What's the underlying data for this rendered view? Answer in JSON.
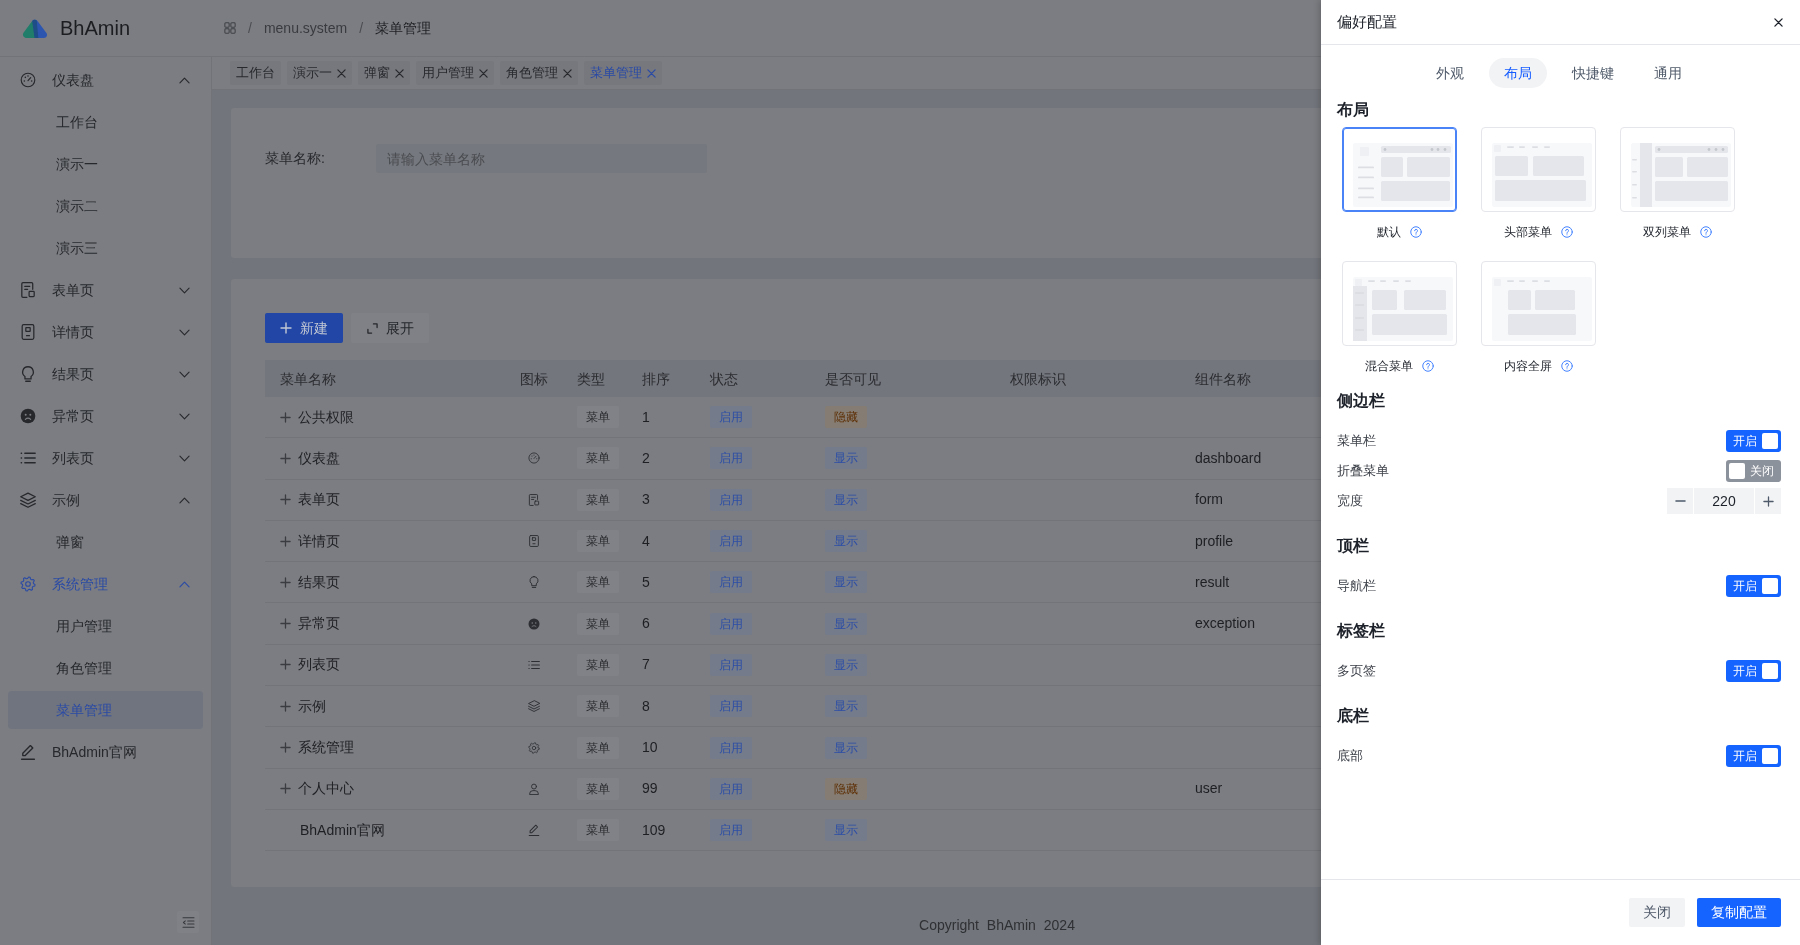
{
  "header": {
    "logo_text": "BhAmin",
    "breadcrumb": [
      {
        "separator": "/",
        "label": "menu.system"
      },
      {
        "separator": "/",
        "label": "菜单管理"
      }
    ]
  },
  "sidebar": {
    "items": [
      {
        "label": "仪表盘",
        "kind": "group",
        "expanded": true,
        "children": [
          {
            "label": "工作台",
            "selected": false
          },
          {
            "label": "演示一",
            "selected": false
          },
          {
            "label": "演示二",
            "selected": false
          },
          {
            "label": "演示三",
            "selected": false
          }
        ]
      },
      {
        "label": "表单页",
        "kind": "group",
        "expanded": false
      },
      {
        "label": "详情页",
        "kind": "group",
        "expanded": false
      },
      {
        "label": "结果页",
        "kind": "group",
        "expanded": false
      },
      {
        "label": "异常页",
        "kind": "group",
        "expanded": false
      },
      {
        "label": "列表页",
        "kind": "group",
        "expanded": false
      },
      {
        "label": "示例",
        "kind": "group",
        "expanded": true,
        "children": [
          {
            "label": "弹窗",
            "selected": false
          }
        ]
      },
      {
        "label": "系统管理",
        "kind": "group",
        "expanded": true,
        "children": [
          {
            "label": "用户管理",
            "selected": false
          },
          {
            "label": "角色管理",
            "selected": false
          },
          {
            "label": "菜单管理",
            "selected": true
          }
        ]
      },
      {
        "label": "BhAdmin官网",
        "kind": "link",
        "selected": false
      }
    ]
  },
  "tabs": [
    {
      "label": "工作台",
      "closable": false,
      "selected": false
    },
    {
      "label": "演示一",
      "closable": true,
      "selected": false
    },
    {
      "label": "弹窗",
      "closable": true,
      "selected": false
    },
    {
      "label": "用户管理",
      "closable": true,
      "selected": false
    },
    {
      "label": "角色管理",
      "closable": true,
      "selected": false
    },
    {
      "label": "菜单管理",
      "closable": true,
      "selected": true
    }
  ],
  "search_form": {
    "label": "菜单名称:",
    "placeholder": "请输入菜单名称"
  },
  "toolbar": [
    {
      "label": "新建",
      "kind": "primary"
    },
    {
      "label": "展开",
      "kind": "secondary"
    }
  ],
  "table": {
    "columns": [
      "菜单名称",
      "图标",
      "类型",
      "排序",
      "状态",
      "是否可见",
      "权限标识",
      "组件名称"
    ],
    "rows": [
      {
        "name": "公共权限",
        "expandable": true,
        "type": "菜单",
        "order": "1",
        "status": "启用",
        "visible": false,
        "visibility": "隐藏"
      },
      {
        "name": "仪表盘",
        "expandable": true,
        "type": "菜单",
        "order": "2",
        "status": "启用",
        "visible": true,
        "visibility": "显示",
        "component": "dashboard"
      },
      {
        "name": "表单页",
        "expandable": true,
        "type": "菜单",
        "order": "3",
        "status": "启用",
        "visible": true,
        "visibility": "显示",
        "component": "form"
      },
      {
        "name": "详情页",
        "expandable": true,
        "type": "菜单",
        "order": "4",
        "status": "启用",
        "visible": true,
        "visibility": "显示",
        "component": "profile"
      },
      {
        "name": "结果页",
        "expandable": true,
        "type": "菜单",
        "order": "5",
        "status": "启用",
        "visible": true,
        "visibility": "显示",
        "component": "result"
      },
      {
        "name": "异常页",
        "expandable": true,
        "type": "菜单",
        "order": "6",
        "status": "启用",
        "visible": true,
        "visibility": "显示",
        "component": "exception"
      },
      {
        "name": "列表页",
        "expandable": true,
        "type": "菜单",
        "order": "7",
        "status": "启用",
        "visible": true,
        "visibility": "显示"
      },
      {
        "name": "示例",
        "expandable": true,
        "type": "菜单",
        "order": "8",
        "status": "启用",
        "visible": true,
        "visibility": "显示"
      },
      {
        "name": "系统管理",
        "expandable": true,
        "type": "菜单",
        "order": "10",
        "status": "启用",
        "visible": true,
        "visibility": "显示"
      },
      {
        "name": "个人中心",
        "expandable": true,
        "type": "菜单",
        "order": "99",
        "status": "启用",
        "visible": false,
        "visibility": "隐藏",
        "component": "user"
      },
      {
        "name": "BhAdmin官网",
        "expandable": false,
        "type": "菜单",
        "order": "109",
        "status": "启用",
        "visible": true,
        "visibility": "显示"
      }
    ]
  },
  "footer": {
    "text": "Copyright BhAmin 2024"
  },
  "drawer": {
    "title": "偏好配置",
    "tabs": [
      {
        "label": "外观",
        "selected": false
      },
      {
        "label": "布局",
        "selected": true
      },
      {
        "label": "快捷键",
        "selected": false
      },
      {
        "label": "通用",
        "selected": false
      }
    ],
    "layout": {
      "heading": "布局",
      "options": [
        {
          "label": "默认",
          "kind": "sidebar",
          "selected": true
        },
        {
          "label": "头部菜单",
          "kind": "top",
          "selected": false
        },
        {
          "label": "双列菜单",
          "kind": "double",
          "selected": false
        },
        {
          "label": "混合菜单",
          "kind": "mixed",
          "selected": false
        },
        {
          "label": "内容全屏",
          "kind": "full",
          "selected": false
        }
      ]
    },
    "sections": [
      {
        "heading": "侧边栏",
        "rows": [
          {
            "label": "菜单栏",
            "kind": "switch",
            "on": true,
            "text": "开启"
          },
          {
            "label": "折叠菜单",
            "kind": "switch",
            "on": false,
            "text": "关闭"
          },
          {
            "label": "宽度",
            "kind": "number",
            "value": "220"
          }
        ]
      },
      {
        "heading": "顶栏",
        "rows": [
          {
            "label": "导航栏",
            "kind": "switch",
            "on": true,
            "text": "开启"
          }
        ]
      },
      {
        "heading": "标签栏",
        "rows": [
          {
            "label": "多页签",
            "kind": "switch",
            "on": true,
            "text": "开启"
          }
        ]
      },
      {
        "heading": "底栏",
        "rows": [
          {
            "label": "底部",
            "kind": "switch",
            "on": true,
            "text": "开启"
          }
        ]
      }
    ],
    "buttons": [
      {
        "label": "关闭",
        "kind": "secondary"
      },
      {
        "label": "复制配置",
        "kind": "primary"
      }
    ]
  }
}
